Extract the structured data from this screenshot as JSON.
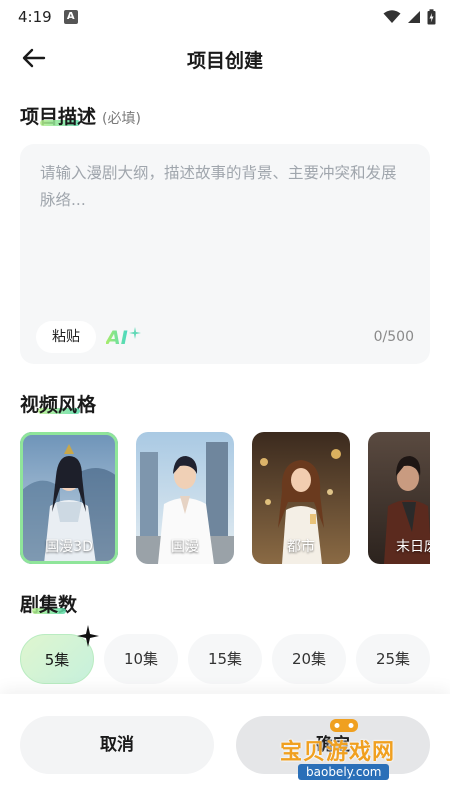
{
  "status_bar": {
    "time": "4:19",
    "app_badge": "A"
  },
  "header": {
    "title": "项目创建"
  },
  "description": {
    "title_pre": "项目",
    "title_hl": "描述",
    "required_note": "(必填)",
    "placeholder": "请输入漫剧大纲，描述故事的背景、主要冲突和发展脉络...",
    "paste_label": "粘贴",
    "ai_label": "AI",
    "counter": "0/500"
  },
  "video_style": {
    "title_pre": "视",
    "title_hl": "频风",
    "title_post": "格",
    "options": [
      {
        "label": "国漫3D",
        "selected": true
      },
      {
        "label": "国漫",
        "selected": false
      },
      {
        "label": "都市",
        "selected": false
      },
      {
        "label": "末日废",
        "selected": false
      }
    ]
  },
  "episodes": {
    "title_pre": "剧",
    "title_hl": "集",
    "title_post": "数",
    "options": [
      {
        "label": "5集",
        "selected": true
      },
      {
        "label": "10集",
        "selected": false
      },
      {
        "label": "15集",
        "selected": false
      },
      {
        "label": "20集",
        "selected": false
      },
      {
        "label": "25集",
        "selected": false
      }
    ]
  },
  "actions": {
    "cancel_label": "取消",
    "confirm_label": "确定"
  },
  "watermark": {
    "main": "宝贝游戏网",
    "url": "baobely.com"
  },
  "colors": {
    "accent_green": "#8fe59a",
    "placeholder": "#a0a6ad",
    "card_bg": "#f6f7f8"
  }
}
